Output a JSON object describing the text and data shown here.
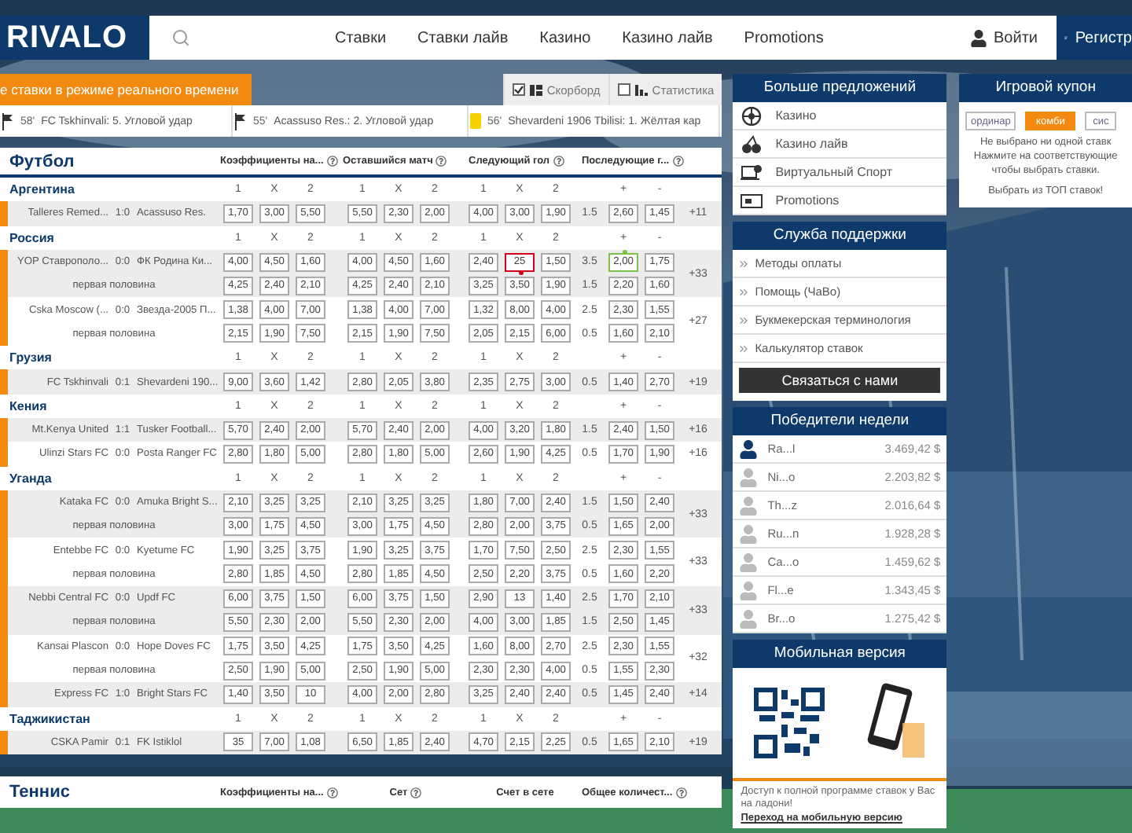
{
  "header": {
    "logo": "RIVALO",
    "nav": [
      "Ставки",
      "Ставки лайв",
      "Казино",
      "Казино лайв",
      "Promotions"
    ],
    "login": "Войти",
    "register": "Регистр"
  },
  "live_banner": "е ставки в режиме реального времени",
  "toggles": [
    {
      "label": "Скорборд",
      "checked": true,
      "kind": "scoreboard"
    },
    {
      "label": "Статистика",
      "checked": false,
      "kind": "stats"
    }
  ],
  "ticker": [
    {
      "kind": "corner",
      "minute": "58'",
      "text": "FC Tskhinvali: 5. Угловой удар"
    },
    {
      "kind": "corner",
      "minute": "55'",
      "text": "Acassuso Res.: 2. Угловой удар"
    },
    {
      "kind": "card",
      "minute": "56'",
      "text": "Shevardeni 1906 Tbilisi: 1. Жёлтая кар"
    }
  ],
  "football": {
    "title": "Футбол",
    "columns": [
      "Коэффициенты на...",
      "Оставшийся матч",
      "Следующий гол",
      "Последующие г..."
    ],
    "leagues": [
      {
        "name": "Аргентина",
        "markers": [
          "1",
          "X",
          "2",
          "1",
          "X",
          "2",
          "1",
          "X",
          "2",
          "+",
          "-"
        ],
        "matches": [
          {
            "home": "Talleres Remed...",
            "score": "1:0",
            "away": "Acassuso Res.",
            "more": "+11",
            "lines": [
              {
                "odds": [
                  "1,70",
                  "3,00",
                  "5,50",
                  "5,50",
                  "2,30",
                  "2,00",
                  "4,00",
                  "3,00",
                  "1,90"
                ],
                "total": "1.5",
                "ou": [
                  "2,60",
                  "1,45"
                ]
              }
            ]
          }
        ]
      },
      {
        "name": "Россия",
        "markers": [
          "1",
          "X",
          "2",
          "1",
          "X",
          "2",
          "1",
          "X",
          "2",
          "+",
          "-"
        ],
        "matches": [
          {
            "home": "YOP Ставрополо...",
            "score": "0:0",
            "away": "ФК Родина Ки...",
            "more": "+33",
            "lines": [
              {
                "odds": [
                  "4,00",
                  "4,50",
                  "1,60",
                  "4,00",
                  "4,50",
                  "1,60",
                  "2,40",
                  "25",
                  "1,50"
                ],
                "total": "3.5",
                "ou": [
                  "2,00",
                  "1,75"
                ],
                "falling": [
                  false,
                  false,
                  false,
                  false,
                  false,
                  false,
                  false,
                  true,
                  false,
                  false,
                  false
                ],
                "rising": [
                  false,
                  false,
                  false,
                  false,
                  false,
                  false,
                  false,
                  false,
                  false,
                  true,
                  false
                ]
              },
              {
                "label": "первая половина",
                "odds": [
                  "4,25",
                  "2,40",
                  "2,10",
                  "4,25",
                  "2,40",
                  "2,10",
                  "3,25",
                  "3,50",
                  "1,90"
                ],
                "total": "1.5",
                "ou": [
                  "2,20",
                  "1,60"
                ]
              }
            ]
          },
          {
            "home": "Cska Moscow (...",
            "score": "0:0",
            "away": "Звезда-2005 П...",
            "more": "+27",
            "lines": [
              {
                "odds": [
                  "1,38",
                  "4,00",
                  "7,00",
                  "1,38",
                  "4,00",
                  "7,00",
                  "1,32",
                  "8,00",
                  "4,00"
                ],
                "total": "2.5",
                "ou": [
                  "2,30",
                  "1,55"
                ]
              },
              {
                "label": "первая половина",
                "odds": [
                  "2,15",
                  "1,90",
                  "7,50",
                  "2,15",
                  "1,90",
                  "7,50",
                  "2,05",
                  "2,15",
                  "6,00"
                ],
                "total": "0.5",
                "ou": [
                  "1,60",
                  "2,10"
                ]
              }
            ]
          }
        ]
      },
      {
        "name": "Грузия",
        "markers": [
          "1",
          "X",
          "2",
          "1",
          "X",
          "2",
          "1",
          "X",
          "2",
          "+",
          "-"
        ],
        "matches": [
          {
            "home": "FC Tskhinvali",
            "score": "0:1",
            "away": "Shevardeni 190...",
            "more": "+19",
            "lines": [
              {
                "odds": [
                  "9,00",
                  "3,60",
                  "1,42",
                  "2,80",
                  "2,05",
                  "3,80",
                  "2,35",
                  "2,75",
                  "3,00"
                ],
                "total": "0.5",
                "ou": [
                  "1,40",
                  "2,70"
                ]
              }
            ]
          }
        ]
      },
      {
        "name": "Кения",
        "markers": [
          "1",
          "X",
          "2",
          "1",
          "X",
          "2",
          "1",
          "X",
          "2",
          "+",
          "-"
        ],
        "matches": [
          {
            "home": "Mt.Kenya United",
            "score": "1:1",
            "away": "Tusker Football...",
            "more": "+16",
            "lines": [
              {
                "odds": [
                  "5,70",
                  "2,40",
                  "2,00",
                  "5,70",
                  "2,40",
                  "2,00",
                  "4,00",
                  "3,20",
                  "1,80"
                ],
                "total": "1.5",
                "ou": [
                  "2,40",
                  "1,50"
                ]
              }
            ]
          },
          {
            "home": "Ulinzi Stars FC",
            "score": "0:0",
            "away": "Posta Ranger FC",
            "more": "+16",
            "lines": [
              {
                "odds": [
                  "2,80",
                  "1,80",
                  "5,00",
                  "2,80",
                  "1,80",
                  "5,00",
                  "2,60",
                  "1,90",
                  "4,25"
                ],
                "total": "0.5",
                "ou": [
                  "1,70",
                  "1,90"
                ]
              }
            ]
          }
        ]
      },
      {
        "name": "Уганда",
        "markers": [
          "1",
          "X",
          "2",
          "1",
          "X",
          "2",
          "1",
          "X",
          "2",
          "+",
          "-"
        ],
        "matches": [
          {
            "home": "Kataka FC",
            "score": "0:0",
            "away": "Amuka Bright S...",
            "more": "+33",
            "lines": [
              {
                "odds": [
                  "2,10",
                  "3,25",
                  "3,25",
                  "2,10",
                  "3,25",
                  "3,25",
                  "1,80",
                  "7,00",
                  "2,40"
                ],
                "total": "1.5",
                "ou": [
                  "1,50",
                  "2,40"
                ]
              },
              {
                "label": "первая половина",
                "odds": [
                  "3,00",
                  "1,75",
                  "4,50",
                  "3,00",
                  "1,75",
                  "4,50",
                  "2,80",
                  "2,00",
                  "3,75"
                ],
                "total": "0.5",
                "ou": [
                  "1,65",
                  "2,00"
                ]
              }
            ]
          },
          {
            "home": "Entebbe FC",
            "score": "0:0",
            "away": "Kyetume FC",
            "more": "+33",
            "lines": [
              {
                "odds": [
                  "1,90",
                  "3,25",
                  "3,75",
                  "1,90",
                  "3,25",
                  "3,75",
                  "1,70",
                  "7,50",
                  "2,50"
                ],
                "total": "2.5",
                "ou": [
                  "2,30",
                  "1,55"
                ]
              },
              {
                "label": "первая половина",
                "odds": [
                  "2,80",
                  "1,85",
                  "4,50",
                  "2,80",
                  "1,85",
                  "4,50",
                  "2,50",
                  "2,20",
                  "3,75"
                ],
                "total": "0.5",
                "ou": [
                  "1,60",
                  "2,20"
                ]
              }
            ]
          },
          {
            "home": "Nebbi Central FC",
            "score": "0:0",
            "away": "Updf FC",
            "more": "+33",
            "lines": [
              {
                "odds": [
                  "6,00",
                  "3,75",
                  "1,50",
                  "6,00",
                  "3,75",
                  "1,50",
                  "2,90",
                  "13",
                  "1,40"
                ],
                "total": "2.5",
                "ou": [
                  "1,70",
                  "2,10"
                ]
              },
              {
                "label": "первая половина",
                "odds": [
                  "5,50",
                  "2,30",
                  "2,00",
                  "5,50",
                  "2,30",
                  "2,00",
                  "4,00",
                  "3,00",
                  "1,85"
                ],
                "total": "1.5",
                "ou": [
                  "2,50",
                  "1,45"
                ]
              }
            ]
          },
          {
            "home": "Kansai Plascon",
            "score": "0:0",
            "away": "Hope Doves FC",
            "more": "+32",
            "lines": [
              {
                "odds": [
                  "1,75",
                  "3,50",
                  "4,25",
                  "1,75",
                  "3,50",
                  "4,25",
                  "1,60",
                  "8,00",
                  "2,70"
                ],
                "total": "2.5",
                "ou": [
                  "2,30",
                  "1,55"
                ]
              },
              {
                "label": "первая половина",
                "odds": [
                  "2,50",
                  "1,90",
                  "5,00",
                  "2,50",
                  "1,90",
                  "5,00",
                  "2,30",
                  "2,30",
                  "4,00"
                ],
                "total": "0.5",
                "ou": [
                  "1,55",
                  "2,30"
                ]
              }
            ]
          },
          {
            "home": "Express FC",
            "score": "1:0",
            "away": "Bright Stars FC",
            "more": "+14",
            "lines": [
              {
                "odds": [
                  "1,40",
                  "3,50",
                  "10",
                  "4,00",
                  "2,00",
                  "2,80",
                  "3,25",
                  "2,40",
                  "2,40"
                ],
                "total": "0.5",
                "ou": [
                  "1,45",
                  "2,40"
                ]
              }
            ]
          }
        ]
      },
      {
        "name": "Таджикистан",
        "markers": [
          "1",
          "X",
          "2",
          "1",
          "X",
          "2",
          "1",
          "X",
          "2",
          "+",
          "-"
        ],
        "matches": [
          {
            "home": "CSKA Pamir",
            "score": "0:1",
            "away": "FK Istiklol",
            "more": "+19",
            "lines": [
              {
                "odds": [
                  "35",
                  "7,00",
                  "1,08",
                  "6,50",
                  "1,85",
                  "2,40",
                  "4,70",
                  "2,15",
                  "2,25"
                ],
                "total": "0.5",
                "ou": [
                  "1,65",
                  "2,10"
                ]
              }
            ]
          }
        ]
      }
    ]
  },
  "tennis": {
    "title": "Теннис",
    "columns": [
      {
        "label": "Коэффициенты на...",
        "help": true
      },
      {
        "label": "Сет",
        "help": true
      },
      {
        "label": "Счет в сете",
        "help": false
      },
      {
        "label": "Общее количест...",
        "help": true
      }
    ]
  },
  "offers": {
    "title": "Больше предложений",
    "items": [
      {
        "kind": "roulette",
        "label": "Казино"
      },
      {
        "kind": "cherries",
        "label": "Казино лайв"
      },
      {
        "kind": "virtual",
        "label": "Виртуальный Спорт"
      },
      {
        "kind": "ticket",
        "label": "Promotions"
      }
    ]
  },
  "support": {
    "title": "Служба поддержки",
    "items": [
      "Методы оплаты",
      "Помощь (ЧаВо)",
      "Букмекерская терминология",
      "Калькулятор ставок"
    ],
    "button": "Связаться с нами"
  },
  "winners": {
    "title": "Победители недели",
    "rows": [
      {
        "name": "Ra...l",
        "amount": "3.469,42 $",
        "current": true
      },
      {
        "name": "Ni...o",
        "amount": "2.203,82 $",
        "current": false
      },
      {
        "name": "Th...z",
        "amount": "2.016,64 $",
        "current": false
      },
      {
        "name": "Ru...n",
        "amount": "1.928,28 $",
        "current": false
      },
      {
        "name": "Ca...o",
        "amount": "1.459,62 $",
        "current": false
      },
      {
        "name": "Fl...e",
        "amount": "1.343,45 $",
        "current": false
      },
      {
        "name": "Br...o",
        "amount": "1.275,42 $",
        "current": false
      }
    ]
  },
  "mobile": {
    "title": "Мобильная версия",
    "text": "Доступ к полной программе ставок у Вас на ладони!",
    "link": "Переход на мобильную версию"
  },
  "coupon": {
    "title": "Игровой купон",
    "tabs": [
      {
        "label": "ординар",
        "selected": false
      },
      {
        "label": "комби",
        "selected": true
      },
      {
        "label": "сис",
        "selected": false
      }
    ],
    "lines": [
      "Не выбрано ни одной ставк",
      "Нажмите на соответствующие",
      "чтобы выбрать ставки.",
      "Выбрать из ТОП ставок!"
    ]
  }
}
